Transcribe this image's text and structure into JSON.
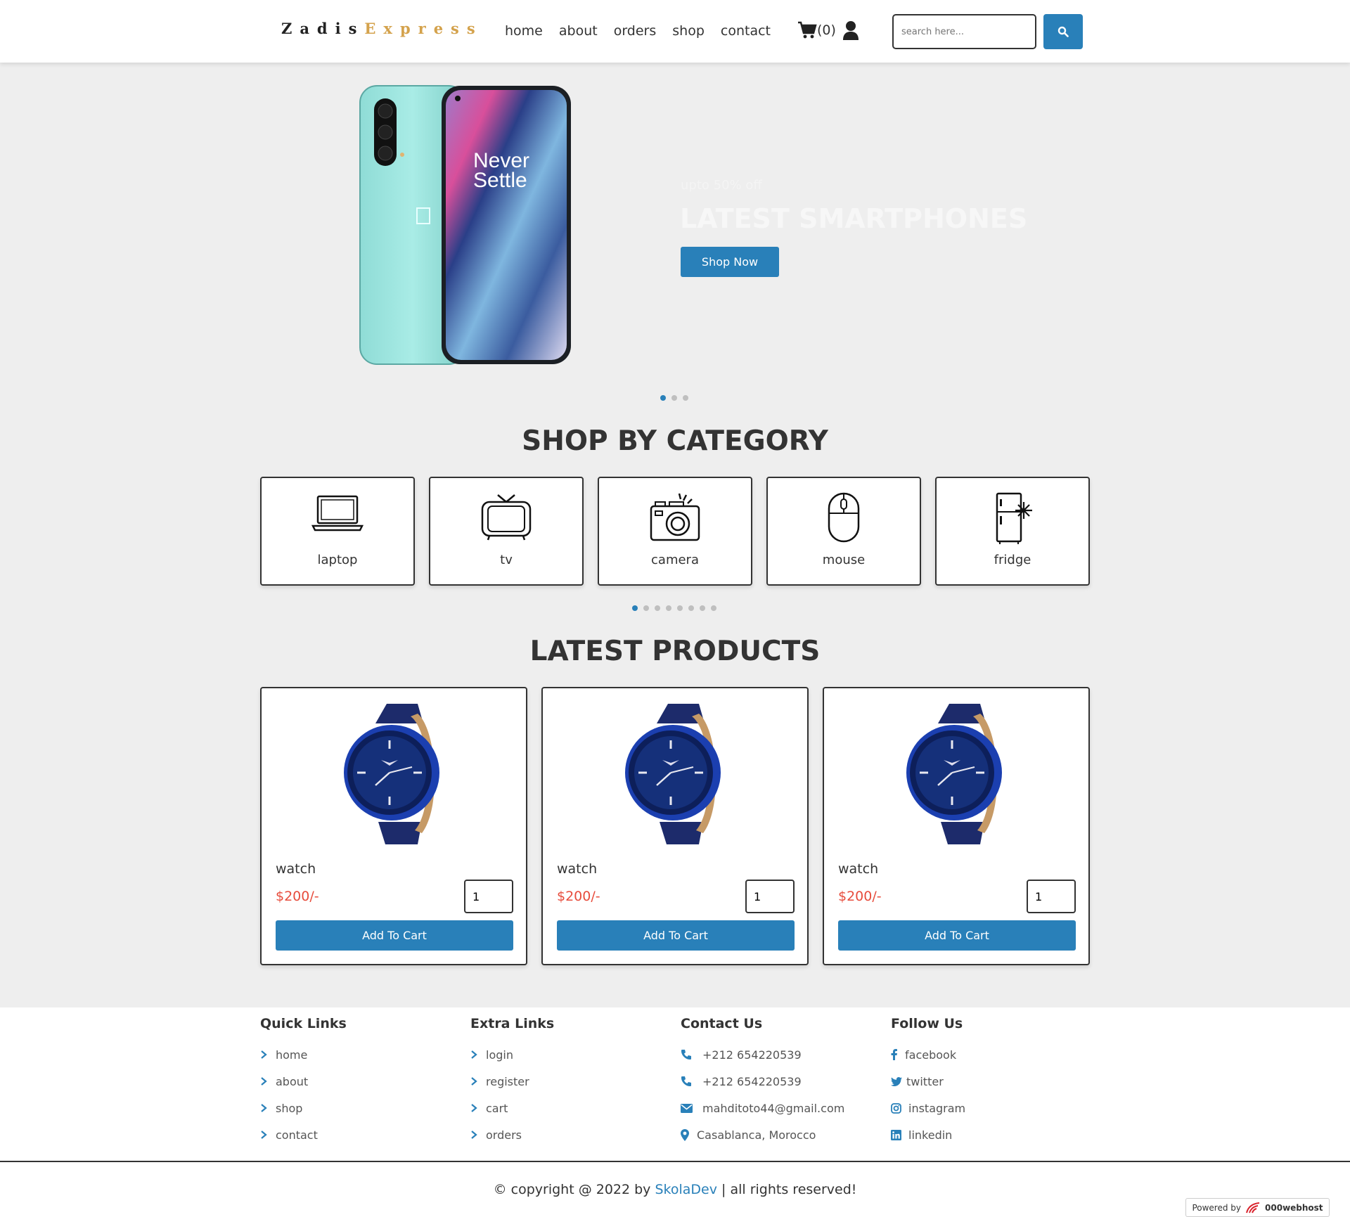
{
  "header": {
    "logo_part1": "Zadis",
    "logo_part2": "Express",
    "nav": [
      "home",
      "about",
      "orders",
      "shop",
      "contact"
    ],
    "cart_count": "(0)",
    "search_placeholder": "search here..."
  },
  "hero": {
    "subtitle": "upto 50% off",
    "title": "LATEST SMARTPHONES",
    "button": "Shop Now",
    "screen_text_1": "Never",
    "screen_text_2": "Settle"
  },
  "categories": {
    "title": "SHOP BY CATEGORY",
    "items": [
      {
        "label": "laptop",
        "icon": "laptop-icon"
      },
      {
        "label": "tv",
        "icon": "tv-icon"
      },
      {
        "label": "camera",
        "icon": "camera-icon"
      },
      {
        "label": "mouse",
        "icon": "mouse-icon"
      },
      {
        "label": "fridge",
        "icon": "fridge-icon"
      }
    ]
  },
  "products": {
    "title": "LATEST PRODUCTS",
    "items": [
      {
        "name": "watch",
        "price": "$200/-",
        "qty": "1",
        "button": "Add To Cart"
      },
      {
        "name": "watch",
        "price": "$200/-",
        "qty": "1",
        "button": "Add To Cart"
      },
      {
        "name": "watch",
        "price": "$200/-",
        "qty": "1",
        "button": "Add To Cart"
      }
    ]
  },
  "footer": {
    "quick_links": {
      "title": "Quick Links",
      "items": [
        "home",
        "about",
        "shop",
        "contact"
      ]
    },
    "extra_links": {
      "title": "Extra Links",
      "items": [
        "login",
        "register",
        "cart",
        "orders"
      ]
    },
    "contact": {
      "title": "Contact Us",
      "items": [
        "+212 654220539",
        "+212 654220539",
        "mahditoto44@gmail.com",
        "Casablanca, Morocco"
      ]
    },
    "follow": {
      "title": "Follow Us",
      "items": [
        "facebook",
        "twitter",
        "instagram",
        "linkedin"
      ]
    },
    "copyright_pre": "© copyright @ 2022 by",
    "copyright_link": "SkolaDev",
    "copyright_post": "| all rights reserved!",
    "powered_by": "Powered by",
    "powered_brand": "000webhost"
  },
  "colors": {
    "accent": "#2980b9",
    "price": "#e74c3c",
    "logo_gold": "#d4a24c"
  }
}
